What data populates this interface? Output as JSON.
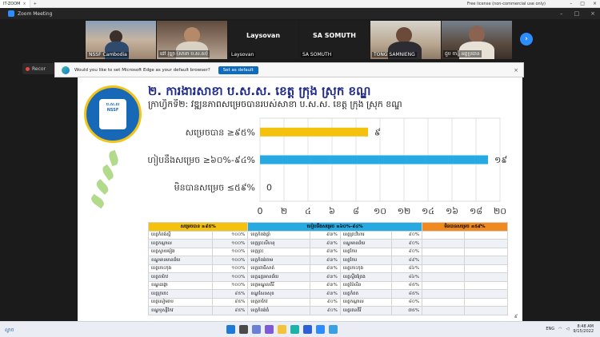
{
  "remote_bar": {
    "tab_title": "IT-ZOOM",
    "license": "Free license (non-commercial use only)"
  },
  "zoom": {
    "window_title": "Zoom Meeting",
    "recording_label": "Recor"
  },
  "participants": [
    {
      "name": "NSSF Cambodia",
      "big": ""
    },
    {
      "name": "ផៅ វុឌ្ឍា (សាខា ប.ស.ស)",
      "big": ""
    },
    {
      "name": "Laysovan",
      "big": "Laysovan"
    },
    {
      "name": "SA SOMUTH",
      "big": "SA SOMUTH"
    },
    {
      "name": "TONG SAMNIENG",
      "big": ""
    },
    {
      "name": "ជួប ចាន្នី អគ្គប្រធាន",
      "big": ""
    }
  ],
  "edge_prompt": {
    "text": "Would you like to set Microsoft Edge as your default browser?",
    "button": "Set as default"
  },
  "slide": {
    "title": "២. ការងារសាខា ប.ស.ស. ខេត្ត ក្រុង ស្រុក ខណ្ឌ",
    "subtitle": "ក្រាហ្វិកទី២: វឌ្ឍនភាពសម្រេចបានរបស់សាខា ប.ស.ស. ខេត្ត ក្រុង ស្រុក ខណ្ឌ",
    "emblem_text": "ប.ស.ស NSSF",
    "page_number": "៩"
  },
  "chart_data": {
    "type": "bar",
    "orientation": "horizontal",
    "categories": [
      "សម្រេចបាន ≥៩៥%",
      "ហៀបនឹងសម្រេច ≥៦០%-៩៤%",
      "មិនបានសម្រេច ≤៥៩%"
    ],
    "values": [
      9,
      19,
      0
    ],
    "value_labels": [
      "៩",
      "១៩",
      "0"
    ],
    "colors": [
      "#f4c20d",
      "#27aae1",
      "#9aa3b5"
    ],
    "xlim": [
      0,
      20
    ],
    "xticks": [
      "0",
      "២",
      "៤",
      "៦",
      "៨",
      "១០",
      "១២",
      "១៤",
      "១៦",
      "១៨",
      "២០"
    ],
    "grid": true,
    "title": "",
    "xlabel": "",
    "ylabel": ""
  },
  "table": {
    "headers": [
      "សម្រេចបាន ≥៩៥%",
      "ហៀបនឹងសម្រេច ≥៦០%-៩៤%",
      "មិនបានសម្រេច ≤៥៩%"
    ],
    "rows": [
      [
        "ខេត្តកំពង់ស្ពឺ",
        "១០០%",
        "ខេត្តកំពង់ធ្លាំ",
        "៩៣%",
        "ខេត្តព្រះវិហារ",
        "៩០%",
        "",
        ""
      ],
      [
        "ខេត្តកណ្ដាល",
        "១០០%",
        "ខេត្តព្រះសីហនុ",
        "៩៣%",
        "ខណ្ឌមានជ័យ",
        "៩០%",
        "",
        ""
      ],
      [
        "ខេត្តស្វាយរៀង",
        "១០០%",
        "ខេត្តព្រះ",
        "៩៣%",
        "ខេត្តកែប",
        "៩០%",
        "",
        ""
      ],
      [
        "ខណ្ឌមានមានជ័យ",
        "១០០%",
        "ខេត្តកំពង់ចាម",
        "៩៣%",
        "ខេត្តកែប",
        "៨៩%",
        "",
        ""
      ],
      [
        "ខេត្តកោះកុង",
        "១០០%",
        "ខេត្តពោធិ៍សាត់",
        "៩៣%",
        "ខេត្តកោះកុង",
        "៨៦%",
        "",
        ""
      ],
      [
        "ខេត្តតាកែវ",
        "១០០%",
        "ខេត្តឧត្តរមានជ័យ",
        "៩៣%",
        "ខេត្តស្ទឹងត្រែង",
        "៨៦%",
        "",
        ""
      ],
      [
        "ខណ្ឌដង្កោ",
        "១០០%",
        "ខេត្តមណ្ឌលគិរី",
        "៩៣%",
        "ខេត្តប៉ៃលិន",
        "៨៥%",
        "",
        ""
      ],
      [
        "ខេត្តក្រចេះ",
        "៩៥%",
        "ខណ្ឌសែនសុខ",
        "៩៣%",
        "ខេត្តកំពត",
        "៨៥%",
        "",
        ""
      ],
      [
        "ខេត្តសៀមរាប",
        "៩៥%",
        "ខេត្តតាកែវ",
        "៩០%",
        "ខេត្តកណ្ដាល",
        "៨០%",
        "",
        ""
      ],
      [
        "ខណ្ឌឫស្សីកែវ",
        "៩៥%",
        "ខេត្តកំពង់ធំ",
        "៩០%",
        "ខេត្តរតនគិរី",
        "៧៥%",
        "",
        ""
      ]
    ]
  },
  "taskbar": {
    "weather": "ល្ងាច",
    "language": "ENG",
    "time": "8:48 AM",
    "date": "9/15/2022"
  }
}
